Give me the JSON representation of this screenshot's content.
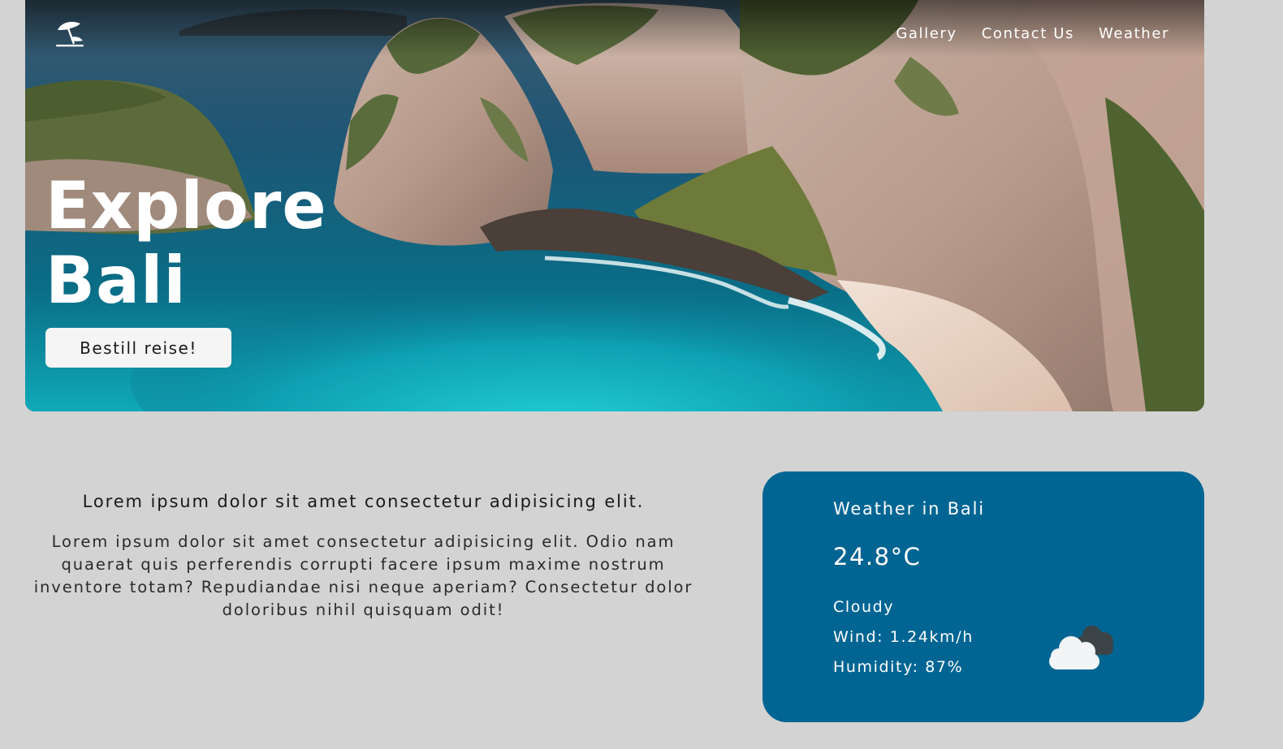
{
  "nav": {
    "logo_icon": "beach-umbrella-icon",
    "links": [
      "Gallery",
      "Contact Us",
      "Weather"
    ]
  },
  "hero": {
    "title_line1": "Explore",
    "title_line2": "Bali",
    "cta_label": "Bestill reise!"
  },
  "info": {
    "heading": "Lorem ipsum dolor sit amet consectetur adipisicing elit.",
    "body": "Lorem ipsum dolor sit amet consectetur adipisicing elit. Odio nam quaerat quis perferendis corrupti facere ipsum maxime nostrum inventore totam? Repudiandae nisi neque aperiam? Consectetur dolor doloribus nihil quisquam odit!"
  },
  "weather": {
    "title": "Weather in Bali",
    "temperature": "24.8°C",
    "description": "Cloudy",
    "wind": "Wind: 1.24km/h",
    "humidity": "Humidity: 87%",
    "icon": "cloudy-icon"
  },
  "colors": {
    "page_background": "#d3d3d3",
    "weather_card": "#006593",
    "cta_background": "#f5f5f5",
    "text_light": "#ffffff",
    "text_dark": "#1a1a1a"
  }
}
